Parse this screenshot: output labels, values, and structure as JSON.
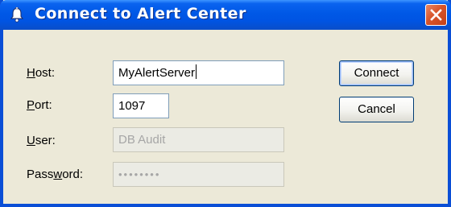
{
  "window": {
    "title": "Connect to Alert Center",
    "icon": "bell-icon",
    "close_icon": "close-icon"
  },
  "form": {
    "host": {
      "label_mnemonic": "H",
      "label_rest": "ost:",
      "value": "MyAlertServer"
    },
    "port": {
      "label_mnemonic": "P",
      "label_rest": "ort:",
      "value": "1097"
    },
    "user": {
      "label_mnemonic": "U",
      "label_rest": "ser:",
      "value": "DB Audit",
      "disabled": true
    },
    "password": {
      "label_pre": "Pass",
      "label_mnemonic": "w",
      "label_rest": "ord:",
      "value": "••••••••",
      "disabled": true
    }
  },
  "buttons": {
    "connect": "Connect",
    "cancel": "Cancel"
  },
  "colors": {
    "titlebar": "#0054e3",
    "window_bg": "#ece9d8",
    "close": "#d8542a"
  }
}
